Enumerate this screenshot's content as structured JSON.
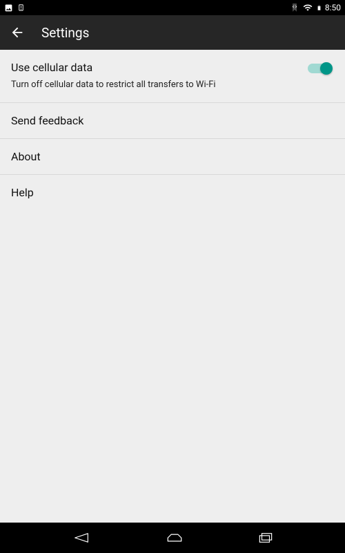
{
  "status": {
    "time": "8:50"
  },
  "header": {
    "title": "Settings"
  },
  "settings": {
    "cellular": {
      "title": "Use cellular data",
      "subtitle": "Turn off cellular data to restrict all transfers to Wi-Fi"
    },
    "feedback": {
      "label": "Send feedback"
    },
    "about": {
      "label": "About"
    },
    "help": {
      "label": "Help"
    }
  }
}
